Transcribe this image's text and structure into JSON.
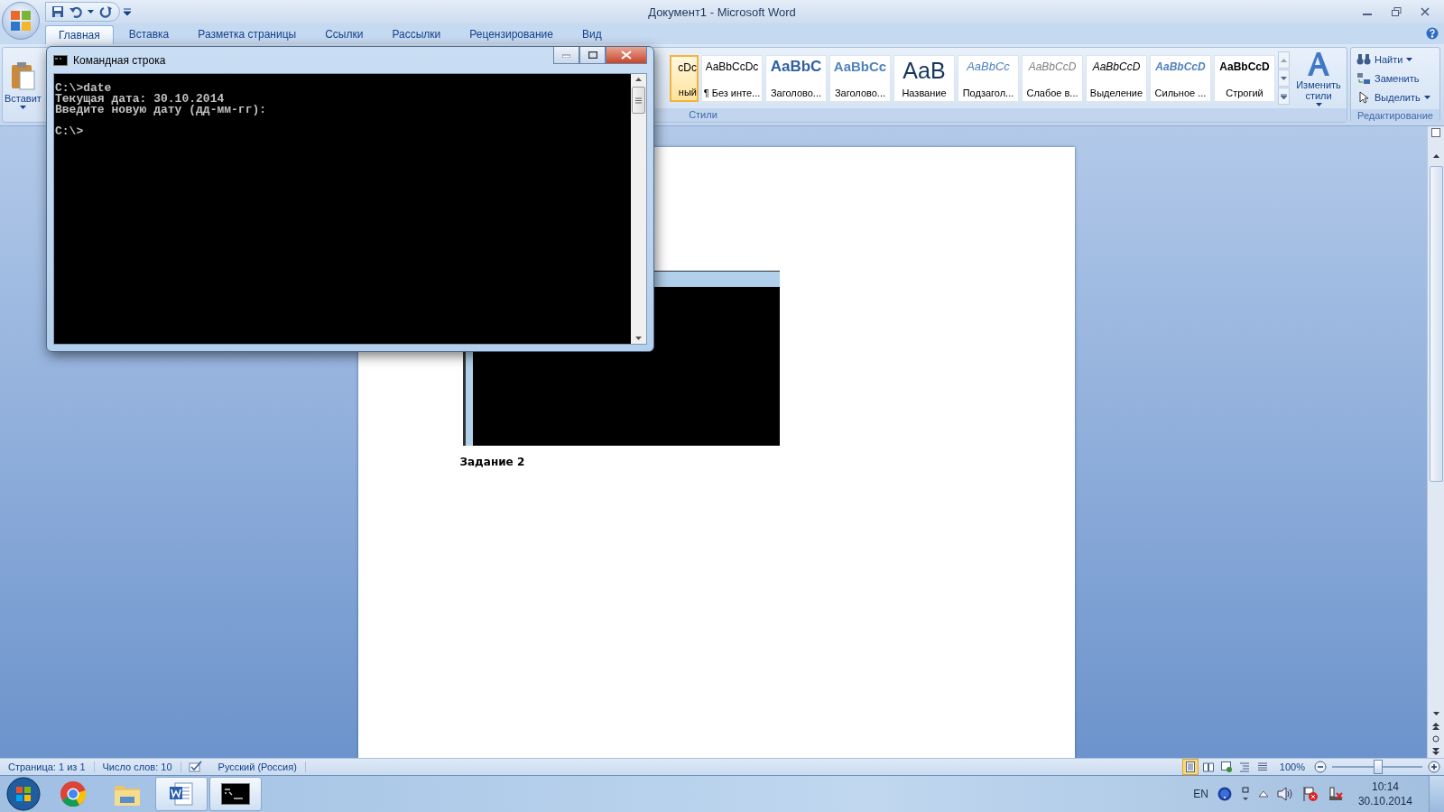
{
  "window": {
    "title": "Документ1 - Microsoft Word"
  },
  "tabs": [
    {
      "label": "Главная",
      "selected": true
    },
    {
      "label": "Вставка",
      "selected": false
    },
    {
      "label": "Разметка страницы",
      "selected": false
    },
    {
      "label": "Ссылки",
      "selected": false
    },
    {
      "label": "Рассылки",
      "selected": false
    },
    {
      "label": "Рецензирование",
      "selected": false
    },
    {
      "label": "Вид",
      "selected": false
    }
  ],
  "clipboard": {
    "paste_label": "Вставит"
  },
  "styles": {
    "group_label": "Стили",
    "change_label": "Изменить стили",
    "items": [
      {
        "kind": "normal",
        "preview": "cDc",
        "name": "ный",
        "selected": true
      },
      {
        "kind": "plain",
        "preview": "AaBbCcDc",
        "name": "¶ Без инте...",
        "selected": false
      },
      {
        "kind": "heading1",
        "preview": "AaBbC",
        "name": "Заголово...",
        "selected": false
      },
      {
        "kind": "heading2",
        "preview": "AaBbCc",
        "name": "Заголово...",
        "selected": false
      },
      {
        "kind": "title",
        "preview": "AaB",
        "name": "Название",
        "selected": false
      },
      {
        "kind": "subtitle",
        "preview": "AaBbCc",
        "name": "Подзагол...",
        "selected": false
      },
      {
        "kind": "subtle",
        "preview": "AaBbCcD",
        "name": "Слабое в...",
        "selected": false
      },
      {
        "kind": "emphasis",
        "preview": "AaBbCcD",
        "name": "Выделение",
        "selected": false
      },
      {
        "kind": "intense",
        "preview": "AaBbCcD",
        "name": "Сильное ...",
        "selected": false
      },
      {
        "kind": "strong",
        "preview": "AaBbCcD",
        "name": "Строгий",
        "selected": false
      }
    ]
  },
  "editing": {
    "group_label": "Редактирование",
    "items": [
      {
        "kind": "find",
        "label": "Найти",
        "dropdown": true
      },
      {
        "kind": "replace",
        "label": "Заменить",
        "dropdown": false
      },
      {
        "kind": "select",
        "label": "Выделить",
        "dropdown": true
      }
    ]
  },
  "document": {
    "paragraphs": [
      "Задание 2"
    ]
  },
  "cmd_window": {
    "title": "Командная строка",
    "output": "C:\\>date\nТекущая дата: 30.10.2014\nВведите новую дату (дд-мм-гг):\n\nC:\\>"
  },
  "status_bar": {
    "page": "Страница: 1 из 1",
    "words": "Число слов: 10",
    "language": "Русский (Россия)",
    "views": [
      {
        "kind": "print",
        "selected": true
      },
      {
        "kind": "reading",
        "selected": false
      },
      {
        "kind": "web",
        "selected": false
      },
      {
        "kind": "outline",
        "selected": false
      },
      {
        "kind": "draft",
        "selected": false
      }
    ],
    "zoom": "100%",
    "zoom_slider": {
      "level": 0.5
    }
  },
  "taskbar": {
    "apps": [
      {
        "kind": "chrome",
        "active": false
      },
      {
        "kind": "explorer",
        "active": false
      },
      {
        "kind": "word",
        "active": true
      },
      {
        "kind": "cmd",
        "active": true
      }
    ],
    "tray": {
      "language": "EN",
      "time": "10:14",
      "date": "30.10.2014"
    }
  }
}
